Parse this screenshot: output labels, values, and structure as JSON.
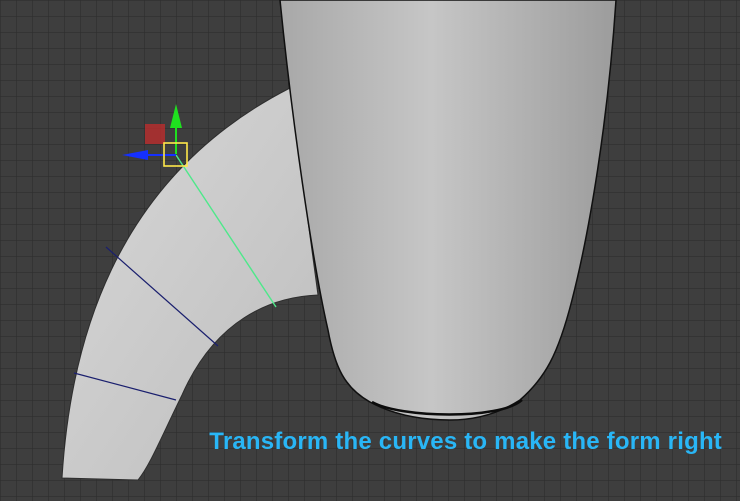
{
  "viewport": {
    "background_color": "#3e3e3e",
    "grid_color": "#2b2b2b",
    "caption": "Transform the curves to make the form right",
    "caption_color": "#29b6f6"
  },
  "objects": {
    "body_mesh_color": "#c4c4c4",
    "arm_mesh_color": "#d6d6d6",
    "edge_loop_color": "#1a1f6e",
    "selected_edge_color": "#4ee88a",
    "selected_vertex_color": "#ffe84a"
  },
  "manipulator": {
    "x_axis_color": "#1530ff",
    "y_axis_color": "#1fe01f",
    "center_color": "#c42c2c"
  }
}
